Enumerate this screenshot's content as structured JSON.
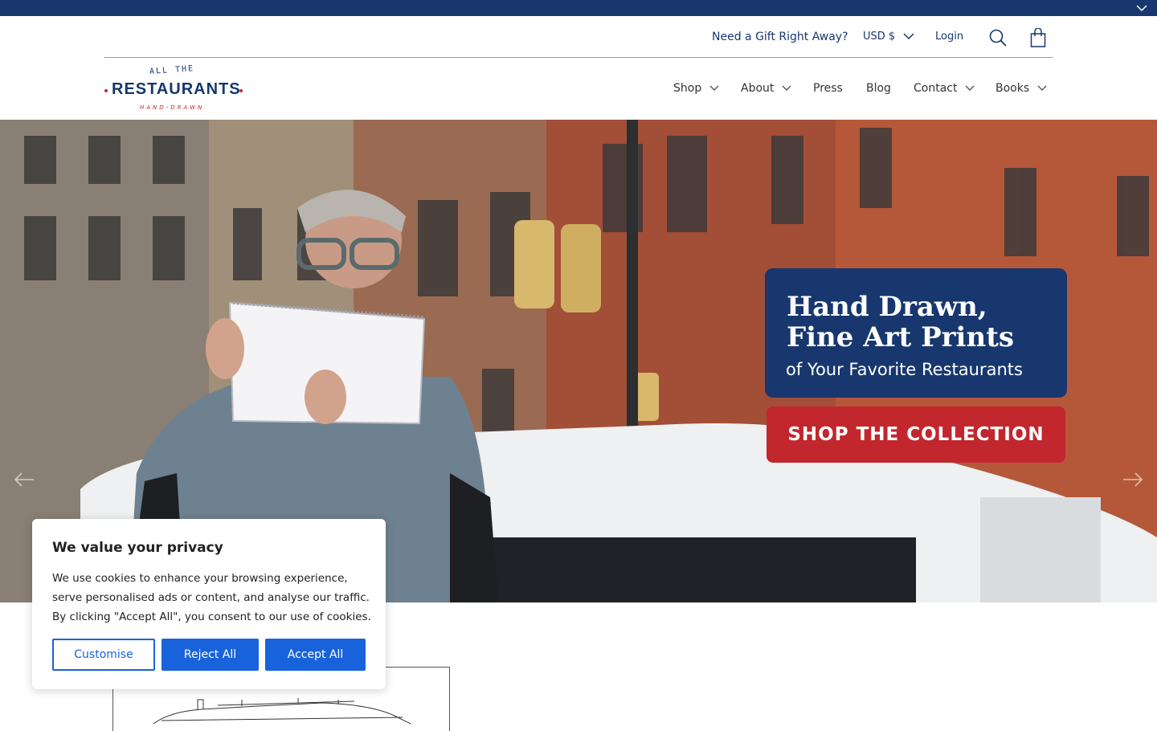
{
  "announcement": {
    "close_icon": "chevron-down-icon"
  },
  "topbar": {
    "gift_link": "Need a Gift Right Away?",
    "currency": "USD $",
    "login": "Login",
    "search_icon": "search-icon",
    "cart_icon": "shopping-bag-icon"
  },
  "logo": {
    "line1": "ALL THE",
    "line2": "RESTAURANTS",
    "line3": "HAND-DRAWN"
  },
  "nav": {
    "items": [
      {
        "label": "Shop",
        "dropdown": true
      },
      {
        "label": "About",
        "dropdown": true
      },
      {
        "label": "Press",
        "dropdown": false
      },
      {
        "label": "Blog",
        "dropdown": false
      },
      {
        "label": "Contact",
        "dropdown": true
      },
      {
        "label": "Books",
        "dropdown": true
      }
    ]
  },
  "hero": {
    "headline1": "Hand Drawn,",
    "headline2": "Fine Art Prints",
    "headline3": "of Your Favorite Restaurants",
    "cta": "SHOP THE COLLECTION",
    "prev_icon": "arrow-left-icon",
    "next_icon": "arrow-right-icon"
  },
  "cookie": {
    "title": "We value your privacy",
    "body": "We use cookies to enhance your browsing experience, serve personalised ads or content, and analyse our traffic. By clicking \"Accept All\", you consent to our use of cookies.",
    "customise": "Customise",
    "reject": "Reject All",
    "accept": "Accept All"
  },
  "colors": {
    "brand_navy": "#17376e",
    "brand_red": "#c2272d",
    "cookie_blue": "#1863dc"
  }
}
